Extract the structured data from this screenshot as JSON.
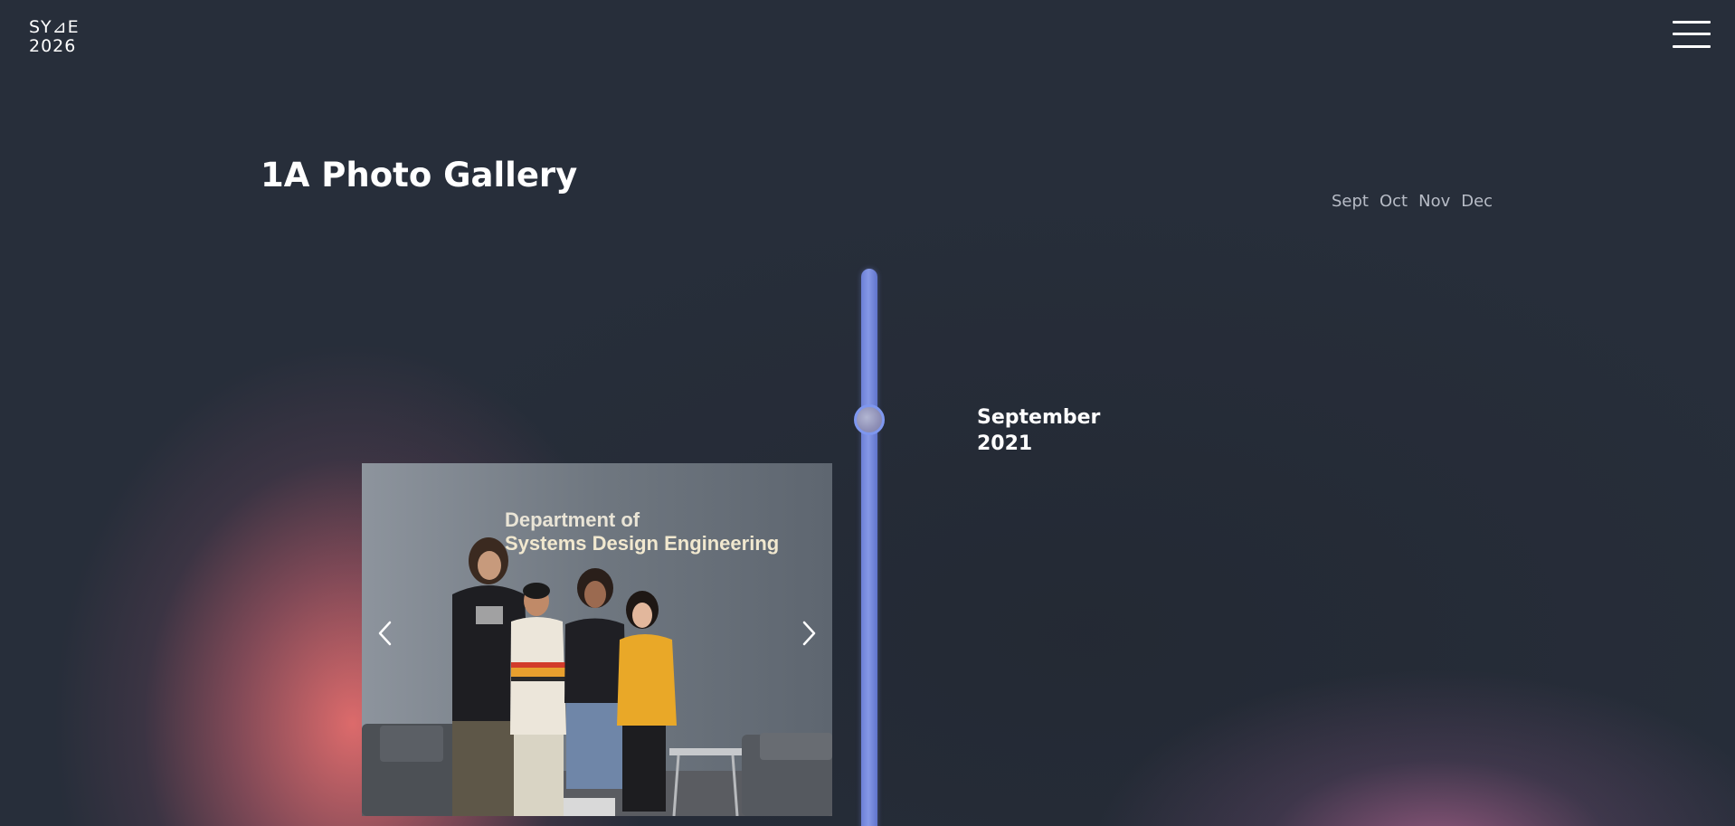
{
  "header": {
    "logo_line1": "SY⊿E",
    "logo_line2": "2026",
    "menu_icon": "hamburger-menu-icon"
  },
  "gallery": {
    "title": "1A Photo Gallery",
    "months": [
      "Sept",
      "Oct",
      "Nov",
      "Dec"
    ]
  },
  "timeline": {
    "month": "September",
    "year": "2021"
  },
  "photo": {
    "wall_sign_line1": "Department of",
    "wall_sign_line2": "Systems Design Engineering",
    "prev_icon": "chevron-left-icon",
    "next_icon": "chevron-right-icon"
  },
  "colors": {
    "background": "#272e3a",
    "accent_timeline": "#7e97ef",
    "glow_pink": "#e06e6e"
  }
}
